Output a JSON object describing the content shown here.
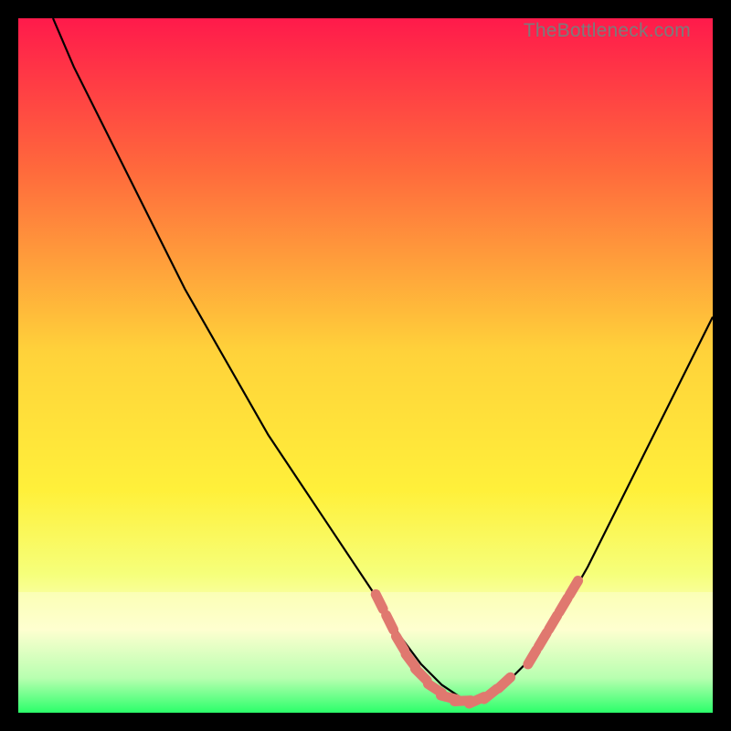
{
  "watermark": "TheBottleneck.com",
  "colors": {
    "gradient_top": "#ff1a4b",
    "gradient_mid_upper": "#ff6a3c",
    "gradient_mid": "#ffd23a",
    "gradient_mid_lower": "#fff03a",
    "gradient_lower": "#f6ff7a",
    "gradient_paleband": "#feffd0",
    "gradient_bottom": "#2bff6a",
    "curve": "#000000",
    "markers": "#e0786f",
    "frame": "#000000"
  },
  "chart_data": {
    "type": "line",
    "title": "",
    "xlabel": "",
    "ylabel": "",
    "xlim": [
      0,
      100
    ],
    "ylim": [
      0,
      100
    ],
    "series": [
      {
        "name": "bottleneck-curve",
        "x": [
          5,
          8,
          12,
          16,
          20,
          24,
          28,
          32,
          36,
          40,
          44,
          48,
          52,
          55,
          58,
          61,
          64,
          67,
          70,
          74,
          78,
          82,
          86,
          90,
          94,
          98,
          100
        ],
        "y": [
          100,
          93,
          85,
          77,
          69,
          61,
          54,
          47,
          40,
          34,
          28,
          22,
          16,
          11,
          7,
          4,
          2,
          2,
          4,
          8,
          14,
          21,
          29,
          37,
          45,
          53,
          57
        ]
      }
    ],
    "markers": {
      "name": "highlight-segments",
      "points": [
        {
          "x": 52,
          "y": 16
        },
        {
          "x": 53.5,
          "y": 13
        },
        {
          "x": 55,
          "y": 10
        },
        {
          "x": 56.5,
          "y": 7.5
        },
        {
          "x": 58,
          "y": 5.5
        },
        {
          "x": 60,
          "y": 3.5
        },
        {
          "x": 62,
          "y": 2.2
        },
        {
          "x": 64,
          "y": 1.7
        },
        {
          "x": 66,
          "y": 1.8
        },
        {
          "x": 68,
          "y": 2.7
        },
        {
          "x": 70,
          "y": 4.3
        },
        {
          "x": 74,
          "y": 8
        },
        {
          "x": 75.5,
          "y": 10.5
        },
        {
          "x": 77,
          "y": 13
        },
        {
          "x": 78.5,
          "y": 15.5
        },
        {
          "x": 80,
          "y": 18
        }
      ]
    }
  }
}
